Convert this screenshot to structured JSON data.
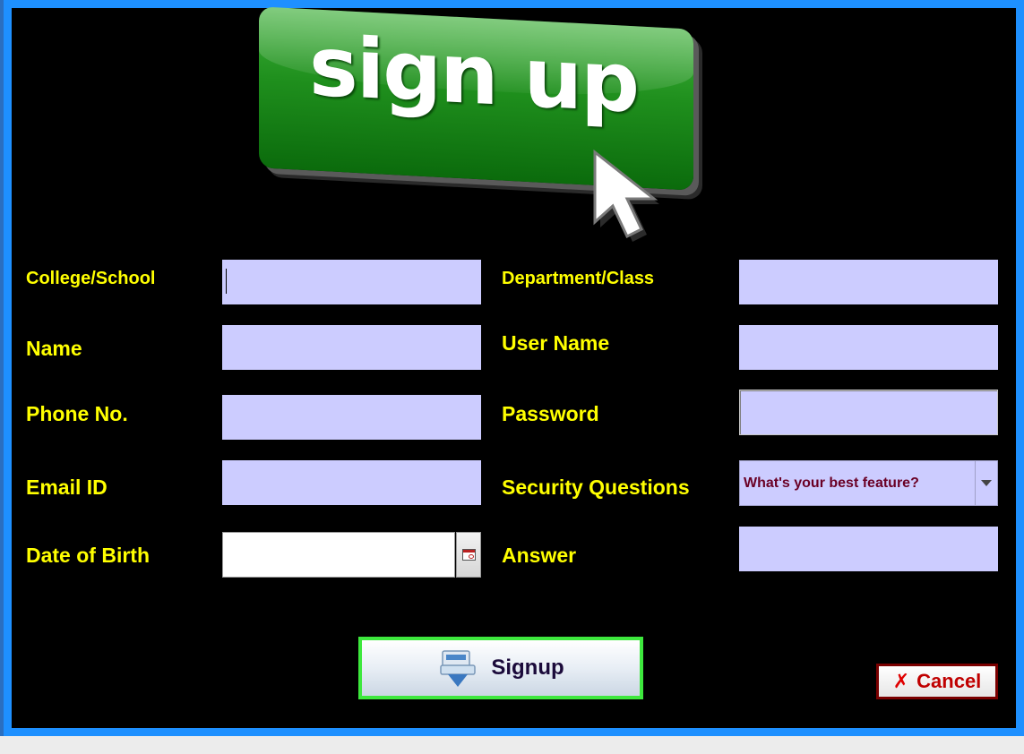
{
  "banner": {
    "text": "sign up"
  },
  "form": {
    "left": [
      {
        "label": "College/School",
        "value": ""
      },
      {
        "label": "Name",
        "value": ""
      },
      {
        "label": "Phone No.",
        "value": ""
      },
      {
        "label": "Email ID",
        "value": ""
      },
      {
        "label": "Date of Birth",
        "value": ""
      }
    ],
    "right": [
      {
        "label": "Department/Class",
        "value": ""
      },
      {
        "label": "User Name",
        "value": ""
      },
      {
        "label": "Password",
        "value": ""
      },
      {
        "label": "Security Questions",
        "selected": "What's your best feature?"
      },
      {
        "label": "Answer",
        "value": ""
      }
    ]
  },
  "buttons": {
    "signup": {
      "label": "Signup",
      "icon": "signup-icon"
    },
    "cancel": {
      "label": "Cancel",
      "icon": "x-icon"
    }
  },
  "colors": {
    "window_border": "#1e90ff",
    "background": "#000000",
    "label": "#ffff00",
    "field": "#ccccff",
    "signup_border": "#3de83d",
    "cancel_border": "#7a0000"
  }
}
